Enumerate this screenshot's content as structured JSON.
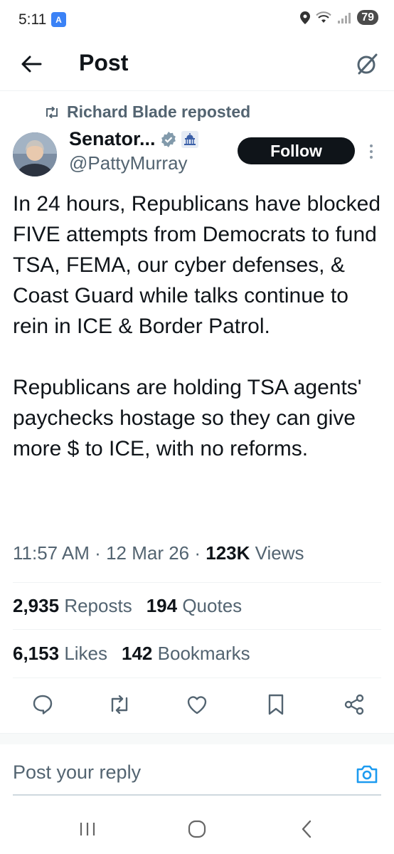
{
  "status_bar": {
    "time": "5:11",
    "battery": "79"
  },
  "header": {
    "title": "Post"
  },
  "repost": {
    "text": "Richard Blade reposted"
  },
  "author": {
    "name": "Senator...",
    "handle": "@PattyMurray"
  },
  "follow_label": "Follow",
  "tweet": {
    "paragraphs": [
      "In 24 hours, Republicans have blocked FIVE attempts from Democrats to fund TSA, FEMA, our cyber defenses, & Coast Guard while talks continue to rein in ICE & Border Patrol.",
      "Republicans are holding TSA agents' paychecks hostage so they can give more $ to ICE, with no reforms."
    ]
  },
  "meta": {
    "time": "11:57 AM",
    "date": "12 Mar 26",
    "views_count": "123K",
    "views_label": "Views"
  },
  "stats": {
    "reposts_count": "2,935",
    "reposts_label": "Reposts",
    "quotes_count": "194",
    "quotes_label": "Quotes",
    "likes_count": "6,153",
    "likes_label": "Likes",
    "bookmarks_count": "142",
    "bookmarks_label": "Bookmarks"
  },
  "reply": {
    "placeholder": "Post your reply"
  },
  "colors": {
    "text_primary": "#0f1419",
    "text_secondary": "#536471",
    "accent": "#1d9bf0",
    "verified_badge": "#829aab"
  },
  "icons": {
    "back": "arrow-left-icon",
    "grok": "grok-icon",
    "repost": "repost-icon",
    "verified": "verified-badge-icon",
    "government": "capitol-icon",
    "more": "more-vertical-icon",
    "reply": "reply-icon",
    "retweet": "repost-icon",
    "like": "heart-icon",
    "bookmark": "bookmark-icon",
    "share": "share-icon",
    "camera": "camera-icon"
  }
}
